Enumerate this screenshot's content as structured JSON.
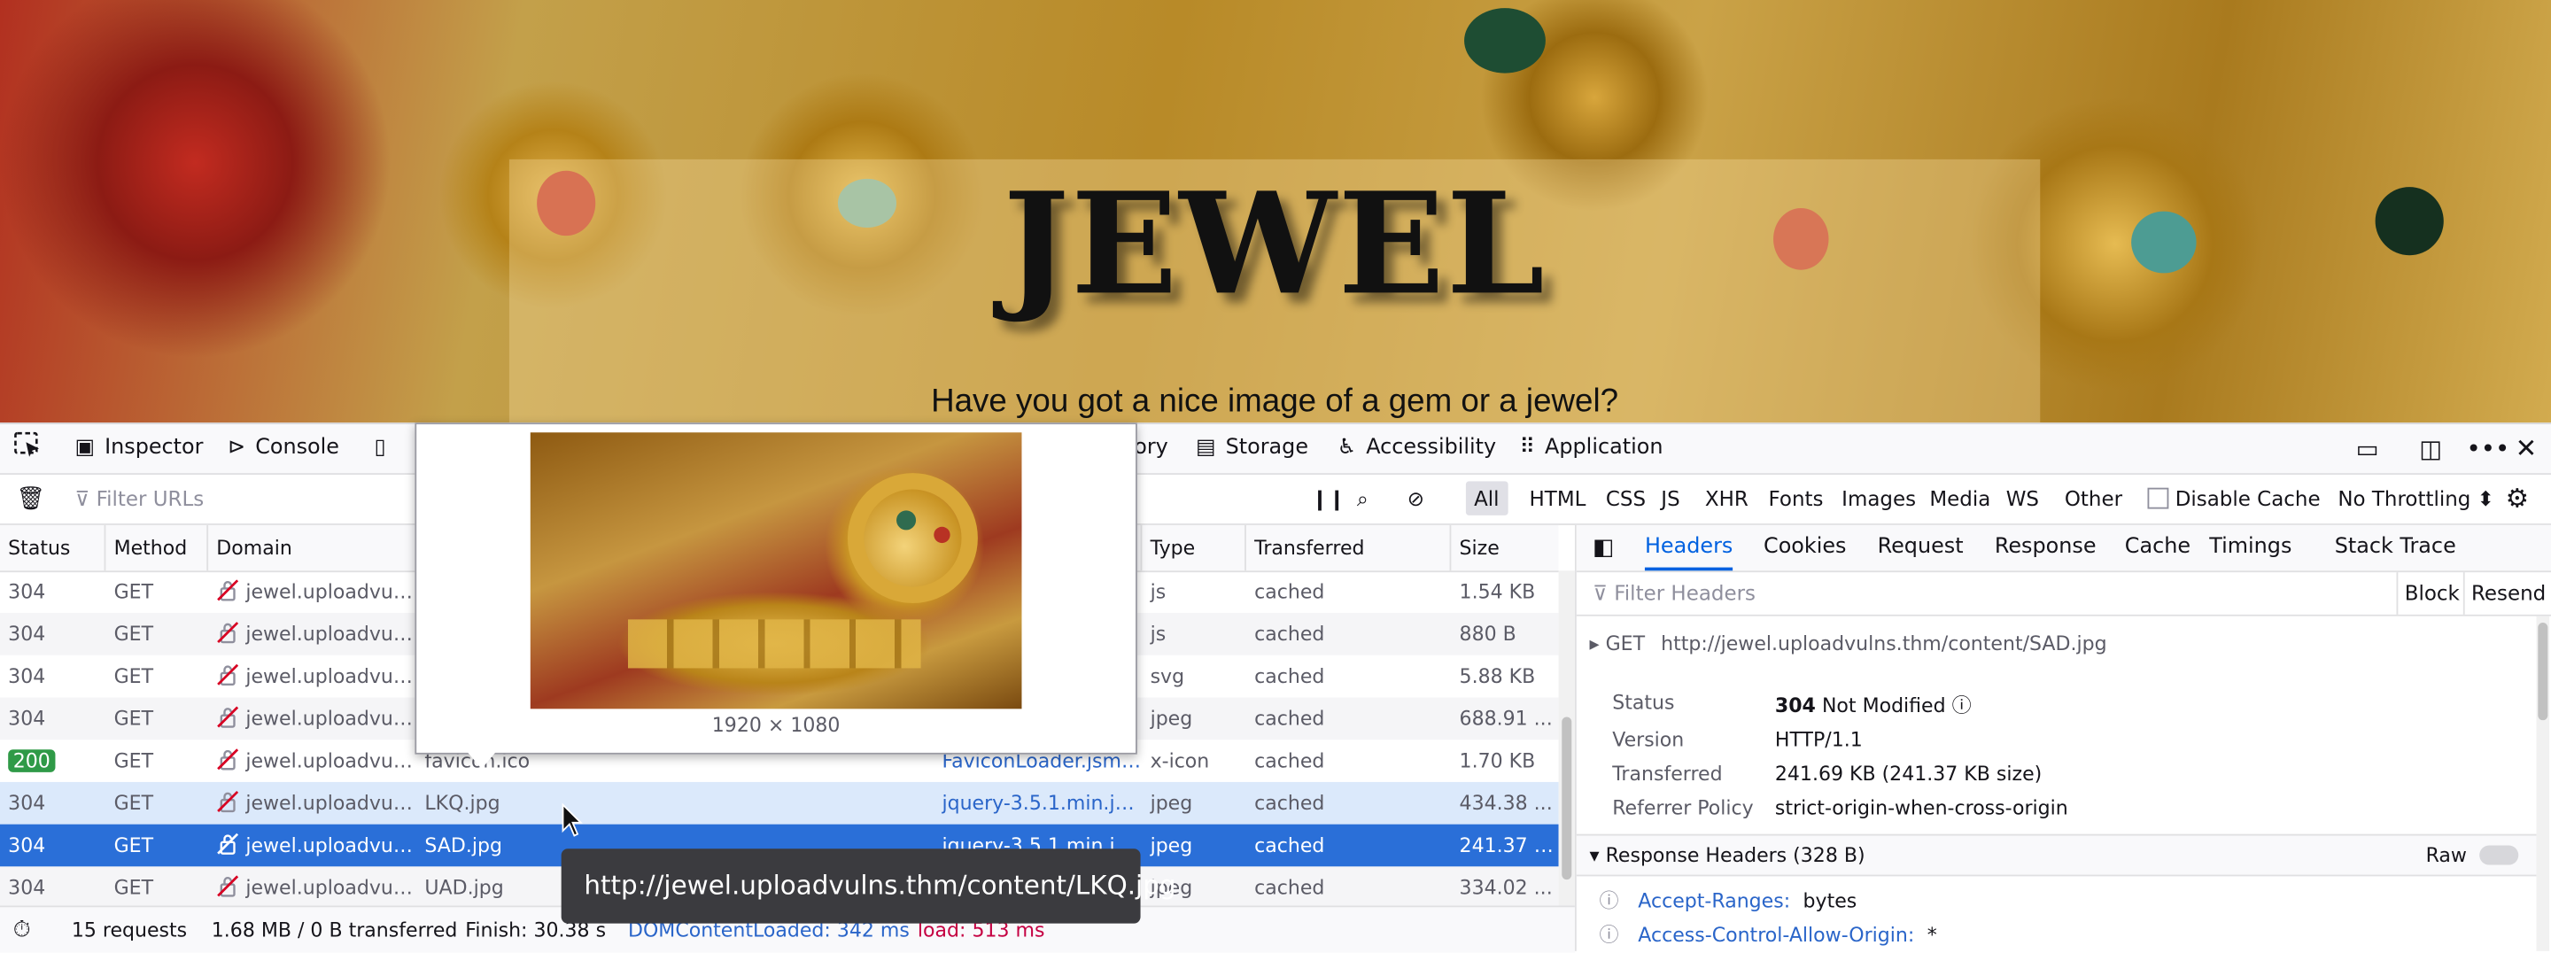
{
  "site": {
    "title": "JEWEL",
    "subtitle": "Have you got a nice image of a gem or a jewel?"
  },
  "devtools": {
    "toolbar": {
      "inspector": "Inspector",
      "console": "Console",
      "memory_partial": "ory",
      "storage": "Storage",
      "accessibility": "Accessibility",
      "application": "Application"
    },
    "filter": {
      "placeholder": "Filter URLs",
      "types": [
        "All",
        "HTML",
        "CSS",
        "JS",
        "XHR",
        "Fonts",
        "Images",
        "Media",
        "WS",
        "Other"
      ],
      "active_type": "All",
      "disable_cache": "Disable Cache",
      "throttling": "No Throttling"
    },
    "columns": [
      "Status",
      "Method",
      "Domain",
      "Type",
      "Transferred",
      "Size"
    ],
    "rows": [
      {
        "status": "304",
        "method": "GET",
        "domain": "jewel.uploadvul...",
        "file": "",
        "initiator": "",
        "type": "js",
        "transferred": "cached",
        "size": "1.54 KB"
      },
      {
        "status": "304",
        "method": "GET",
        "domain": "jewel.uploadvul...",
        "file": "",
        "initiator": "",
        "type": "js",
        "transferred": "cached",
        "size": "880 B"
      },
      {
        "status": "304",
        "method": "GET",
        "domain": "jewel.uploadvul...",
        "file": "",
        "initiator": "",
        "type": "svg",
        "transferred": "cached",
        "size": "5.88 KB"
      },
      {
        "status": "304",
        "method": "GET",
        "domain": "jewel.uploadvul...",
        "file": "",
        "initiator": "",
        "type": "jpeg",
        "transferred": "cached",
        "size": "688.91 ..."
      },
      {
        "status": "200",
        "method": "GET",
        "domain": "jewel.uploadvul...",
        "file": "favicon.ico",
        "initiator": "FaviconLoader.jsm:...",
        "type": "x-icon",
        "transferred": "cached",
        "size": "1.70 KB"
      },
      {
        "status": "304",
        "method": "GET",
        "domain": "jewel.uploadvul...",
        "file": "LKQ.jpg",
        "initiator": "jquery-3.5.1.min.js:...",
        "type": "jpeg",
        "transferred": "cached",
        "size": "434.38 ..."
      },
      {
        "status": "304",
        "method": "GET",
        "domain": "jewel.uploadvul...",
        "file": "SAD.jpg",
        "initiator": "jquery-3.5.1.min.js:...",
        "type": "jpeg",
        "transferred": "cached",
        "size": "241.37 KB"
      },
      {
        "status": "304",
        "method": "GET",
        "domain": "jewel.uploadvul...",
        "file": "UAD.jpg",
        "initiator": "jquery-3.5.1.min.js:...",
        "type": "jpeg",
        "transferred": "cached",
        "size": "334.02 ..."
      }
    ],
    "statusbar": {
      "requests": "15 requests",
      "transferred": "1.68 MB / 0 B transferred",
      "finish": "Finish: 30.38 s",
      "dcl": "DOMContentLoaded: 342 ms",
      "load": "load: 513 ms"
    },
    "panel": {
      "tabs": [
        "Headers",
        "Cookies",
        "Request",
        "Response",
        "Cache",
        "Timings",
        "Stack Trace"
      ],
      "active_tab": "Headers",
      "filter_placeholder": "Filter Headers",
      "block": "Block",
      "resend": "Resend",
      "request_line": "GET",
      "request_url": "http://jewel.uploadvulns.thm/content/SAD.jpg",
      "fields": [
        {
          "key": "Status",
          "value": "304",
          "extra": "Not Modified"
        },
        {
          "key": "Version",
          "value": "HTTP/1.1"
        },
        {
          "key": "Transferred",
          "value": "241.69 KB (241.37 KB size)"
        },
        {
          "key": "Referrer Policy",
          "value": "strict-origin-when-cross-origin"
        }
      ],
      "response_headers_title": "Response Headers (328 B)",
      "raw": "Raw",
      "headers": [
        {
          "name": "Accept-Ranges:",
          "value": "bytes"
        },
        {
          "name": "Access-Control-Allow-Origin:",
          "value": "*"
        }
      ]
    },
    "image_tooltip": {
      "dims": "1920 × 1080"
    },
    "url_tooltip": "http://jewel.uploadvulns.thm/content/LKQ.jpg"
  }
}
